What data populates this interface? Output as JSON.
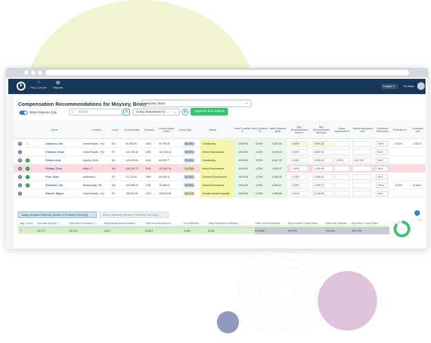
{
  "app": {
    "nav": [
      {
        "label": "Pay & people",
        "icon": "people-icon"
      },
      {
        "label": "Reports",
        "icon": "reports-icon"
      }
    ],
    "language": "English",
    "user": "Hi, Brian"
  },
  "page": {
    "title": "Compensation Recommendations for Moysey, Brian",
    "employee_select": "Moysey, Brian",
    "direct_reports_label": "Direct Reports Only",
    "search_placeholder": "Search",
    "comp_statements": "Comp Statements for ...",
    "approve_label": "Approve and Submit"
  },
  "grid": {
    "headers": [
      "Name",
      "Location",
      "Level",
      "Current Salary",
      "Currency",
      "Current Salary (USD)",
      "Comp Ratio",
      "Rating",
      "Merit Proration %",
      "Merit Guidance %",
      "Merit Guidance (Amt)",
      "Mgr Recommended Merit %",
      "Mgr Recommended Merit Amt",
      "Salary Adjustment %",
      "Market Adjustment Amt",
      "Promotion Recommen",
      "Promotion %",
      "Promotion Amt"
    ],
    "rows": [
      {
        "name": "Anderson, Gia",
        "location": "Grand Rapids - HQ",
        "level": "M3",
        "salary": "90,750.00",
        "currency": "USD",
        "salary_usd": "90,750.00",
        "comp_ratio": "96.06%",
        "rating": "Outstanding",
        "proration": "100.00%",
        "guidance_pct": "5.00%",
        "guidance_amt": "4,537.50",
        "mgr_pct": "5.00%",
        "mgr_amt": "4,091.23",
        "adj_pct": "",
        "market_amt": "",
        "promo": "Yes",
        "promo_pct": "5.00%",
        "promo_amt": "4,537.5",
        "status": "warning",
        "flag": false
      },
      {
        "name": "Chamizo, Xinya",
        "location": "Grand Rapids - HQ",
        "level": "P3",
        "salary": "122,190.32",
        "currency": "USD",
        "salary_usd": "122,190.32",
        "comp_ratio": "98.09%",
        "rating": "Meets Expectations",
        "proration": "100.00%",
        "guidance_pct": "4.25%",
        "guidance_amt": "5,193.09",
        "mgr_pct": "4.00%",
        "mgr_amt": "4,887.61",
        "adj_pct": "",
        "market_amt": "",
        "promo": "No",
        "promo_pct": "",
        "promo_amt": "",
        "status": "none",
        "flag": false
      },
      {
        "name": "Forbes, Aron",
        "location": "Sydney, NSW",
        "level": "M3",
        "salary": "120,099.60",
        "currency": "AUD",
        "salary_usd": "80,599.77",
        "comp_ratio": "90.89%",
        "rating": "Outstanding",
        "proration": "100.00%",
        "guidance_pct": "5.25%",
        "guidance_amt": "6,347.22",
        "mgr_pct": "5.25%",
        "mgr_amt": "6,305.23",
        "adj_pct": "2.00%",
        "market_amt": "2417.69",
        "promo": "No",
        "promo_pct": "",
        "promo_amt": "",
        "status": "ok",
        "flag": false
      },
      {
        "name": "Phillips, Chas",
        "location": "Milan, IT",
        "level": "M4",
        "salary": "100,102.72",
        "currency": "EUR",
        "salary_usd": "107,857.34",
        "comp_ratio": "114.09%",
        "rating": "Meets Expectations",
        "proration": "100.00%",
        "guidance_pct": "4.25%",
        "guidance_amt": "4,254.37",
        "mgr_pct": "1.00%",
        "mgr_amt": "1,000.00",
        "adj_pct": "",
        "market_amt": "",
        "promo": "No",
        "promo_pct": "",
        "promo_amt": "",
        "status": "ok",
        "flag": true
      },
      {
        "name": "Price, Sean",
        "location": "Addlesbury",
        "level": "P1",
        "salary": "70,720.00",
        "currency": "GBP",
        "salary_usd": "89,539.11",
        "comp_ratio": "93.66%",
        "rating": "Exceeds Expectations",
        "proration": "100.00%",
        "guidance_pct": "4.75%",
        "guidance_amt": "3,359.20",
        "mgr_pct": "4.75%",
        "mgr_amt": "3,359.20",
        "adj_pct": "",
        "market_amt": "",
        "promo": "No",
        "promo_pct": "",
        "promo_amt": "",
        "status": "ok",
        "flag": false
      },
      {
        "name": "Robinson, Jeri",
        "location": "Mississauga, ON",
        "level": "M3",
        "salary": "103,365.00",
        "currency": "CAD",
        "salary_usd": "75,468.91",
        "comp_ratio": "96.09%",
        "rating": "Meets Expectations",
        "proration": "100.00%",
        "guidance_pct": "4.25%",
        "guidance_amt": "4,393.01",
        "mgr_pct": "2.25%",
        "mgr_amt": "2,325.71",
        "adj_pct": "",
        "market_amt": "",
        "promo": "Yes",
        "promo_pct": "5.00%",
        "promo_amt": "5,168.2",
        "status": "ok",
        "flag": false
      },
      {
        "name": "Russell, Wayne",
        "location": "Grand Rapids - HQ",
        "level": "P5",
        "salary": "106,932.69",
        "currency": "USD",
        "salary_usd": "106,932.69",
        "comp_ratio": "104.27%",
        "rating": "Partially Meets Expectati",
        "proration": "100.00%",
        "guidance_pct": "3.75%",
        "guidance_amt": "4,009.66",
        "mgr_pct": "2.00%",
        "mgr_amt": "2,138.66",
        "adj_pct": "",
        "market_amt": "",
        "promo": "No",
        "promo_pct": "",
        "promo_amt": "",
        "status": "none",
        "flag": false
      }
    ]
  },
  "summary": {
    "tabs": [
      "Salary Increase Summary (Shown in Preferred Currency)",
      "Bonus Summary (shown in Preferred Currency)"
    ],
    "headers": [
      "Mgr. Count",
      "Increase Budget",
      "Total Merit Increases",
      "Total Adjustment Increases",
      "Total Increase Amount",
      "Pool Balance",
      "Total Promotion Increases",
      "Total Current Salaries",
      "Avg Current Compa Ratio",
      "Total New Salaries",
      "Avg New Compa Ratio"
    ],
    "values": [
      "7",
      "29,077",
      "25,175",
      "1,612",
      "24,887",
      "4,190",
      "8,218",
      "673,088",
      "99.02%",
      "706,283",
      "103.79%"
    ],
    "donut_fraction": 0.86,
    "colors": {
      "donut": "#3cbf6e",
      "donut_track": "#dfe5ea"
    }
  }
}
